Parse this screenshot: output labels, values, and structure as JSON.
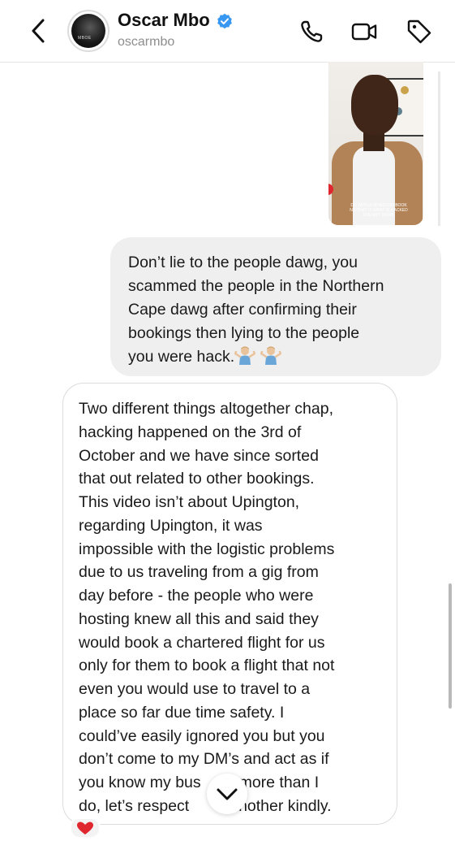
{
  "header": {
    "name": "Oscar Mbo",
    "handle": "oscarmbo",
    "verified": true,
    "avatar_text": "MBOE"
  },
  "shared_media": {
    "caption_lines": [
      "DO WITH A UPINGTON BOOK",
      "NO THAT IS WHAT IS HACKED",
      "DOESN'T WORK"
    ]
  },
  "messages": [
    {
      "direction": "outgoing",
      "lines": [
        "Don’t lie to the people dawg, you",
        "scammed the people in the Northern",
        "Cape dawg after confirming their",
        "bookings then lying to the people",
        "you were hack."
      ],
      "trailing_emoji": [
        "person-shrugging-emoji",
        "person-shrugging-emoji"
      ]
    },
    {
      "direction": "incoming",
      "lines": [
        "Two different things altogether chap,",
        "hacking happened on the 3rd of",
        "October and we have since sorted",
        "that out related to other bookings.",
        "This video isn’t about Upington,",
        "regarding Upington, it was",
        "impossible with the logistic problems",
        "due to us traveling from a gig from",
        "day before - the people who were",
        "hosting knew all this and said they",
        "would book a chartered flight for us",
        "only for them to book a flight that not",
        "even you would use to travel to a",
        "place so far due time safety. I",
        "could’ve easily ignored you but you",
        "don’t come to my DM’s and act as if",
        "you know my bus",
        "do, let’s respect"
      ],
      "line_tails": {
        "16": "ss more than I",
        "17": "another kindly."
      },
      "reaction": "heart-emoji"
    }
  ],
  "colors": {
    "verified_blue": "#3897f0",
    "outgoing_bubble": "#efefef",
    "heart_red": "#e0262f"
  },
  "icons": [
    "chevron-left-icon",
    "phone-icon",
    "video-camera-icon",
    "tag-icon",
    "chevron-down-icon"
  ]
}
